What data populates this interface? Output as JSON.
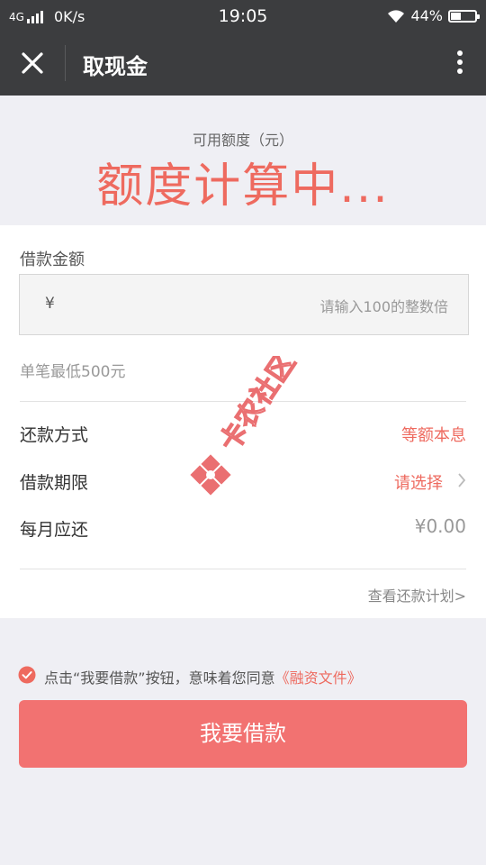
{
  "statusbar": {
    "network": "4G",
    "speed": "0K/s",
    "time": "19:05",
    "battery_text": "44%",
    "battery_level": 0.44
  },
  "header": {
    "title": "取现金",
    "close_icon": "close-icon",
    "more_icon": "more-vertical-icon"
  },
  "quota": {
    "label": "可用额度（元）",
    "value": "额度计算中..."
  },
  "form": {
    "amount_label": "借款金额",
    "currency_symbol": "¥",
    "amount_value": "",
    "amount_placeholder": "请输入100的整数倍",
    "min_note": "单笔最低500元",
    "rows": [
      {
        "label": "还款方式",
        "value": "等额本息"
      },
      {
        "label": "借款期限",
        "value": "请选择"
      },
      {
        "label": "每月应还",
        "value": "¥0.00"
      }
    ],
    "plan_link": "查看还款计划>"
  },
  "agreement": {
    "checked": true,
    "text": "点击“我要借款”按钮，意味着您同意",
    "link": "《融资文件》"
  },
  "cta_label": "我要借款",
  "watermark": {
    "text": "卡农社区"
  },
  "colors": {
    "accent": "#ee6a5f",
    "button": "#f27271",
    "header": "#3c3d3f",
    "background": "#efeff4"
  }
}
